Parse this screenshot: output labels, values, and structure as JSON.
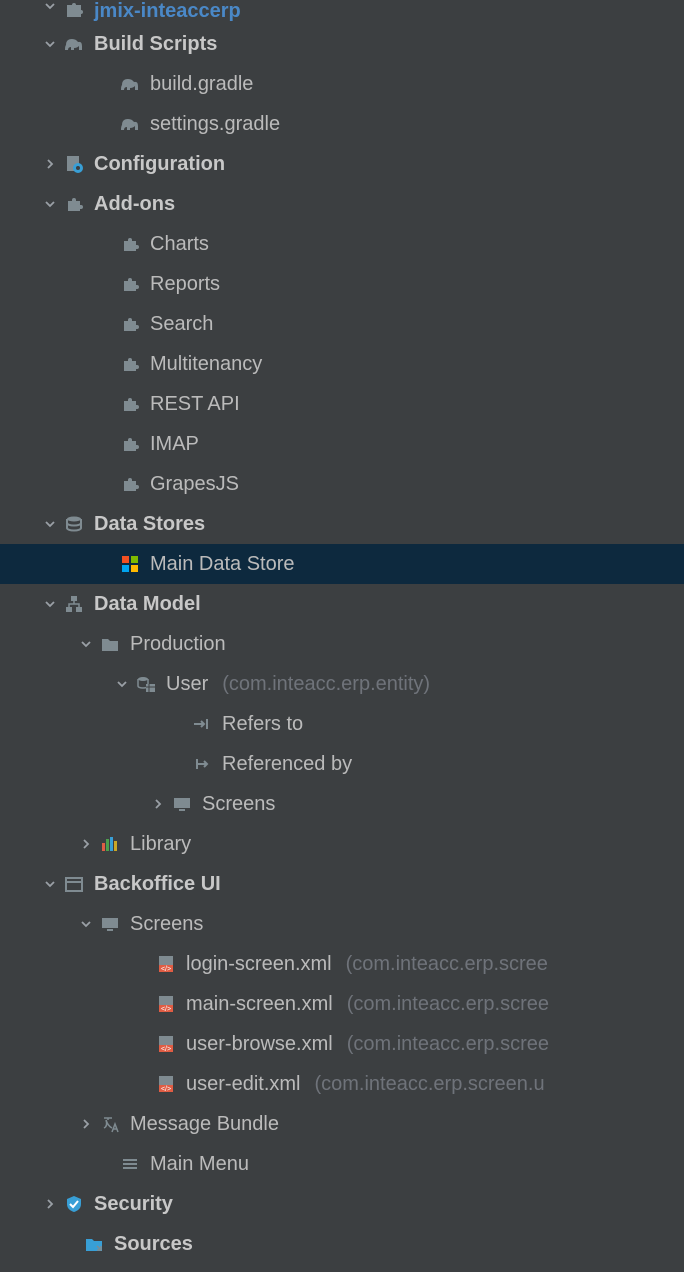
{
  "project": {
    "name": "jmix-inteaccerp"
  },
  "buildScripts": {
    "label": "Build Scripts",
    "items": [
      {
        "label": "build.gradle"
      },
      {
        "label": "settings.gradle"
      }
    ]
  },
  "configuration": {
    "label": "Configuration"
  },
  "addons": {
    "label": "Add-ons",
    "items": [
      {
        "label": "Charts"
      },
      {
        "label": "Reports"
      },
      {
        "label": "Search"
      },
      {
        "label": "Multitenancy"
      },
      {
        "label": "REST API"
      },
      {
        "label": "IMAP"
      },
      {
        "label": "GrapesJS"
      }
    ]
  },
  "dataStores": {
    "label": "Data Stores",
    "items": [
      {
        "label": "Main Data Store"
      }
    ]
  },
  "dataModel": {
    "label": "Data Model",
    "production": {
      "label": "Production",
      "user": {
        "label": "User",
        "hint": "(com.inteacc.erp.entity)",
        "refersTo": "Refers to",
        "referencedBy": "Referenced by",
        "screens": "Screens"
      }
    },
    "library": {
      "label": "Library"
    }
  },
  "backoffice": {
    "label": "Backoffice UI",
    "screens": {
      "label": "Screens",
      "items": [
        {
          "label": "login-screen.xml",
          "hint": "(com.inteacc.erp.scree"
        },
        {
          "label": "main-screen.xml",
          "hint": "(com.inteacc.erp.scree"
        },
        {
          "label": "user-browse.xml",
          "hint": "(com.inteacc.erp.scree"
        },
        {
          "label": "user-edit.xml",
          "hint": "(com.inteacc.erp.screen.u"
        }
      ]
    },
    "messageBundle": {
      "label": "Message Bundle"
    },
    "mainMenu": {
      "label": "Main Menu"
    }
  },
  "security": {
    "label": "Security"
  },
  "sources": {
    "label": "Sources"
  }
}
